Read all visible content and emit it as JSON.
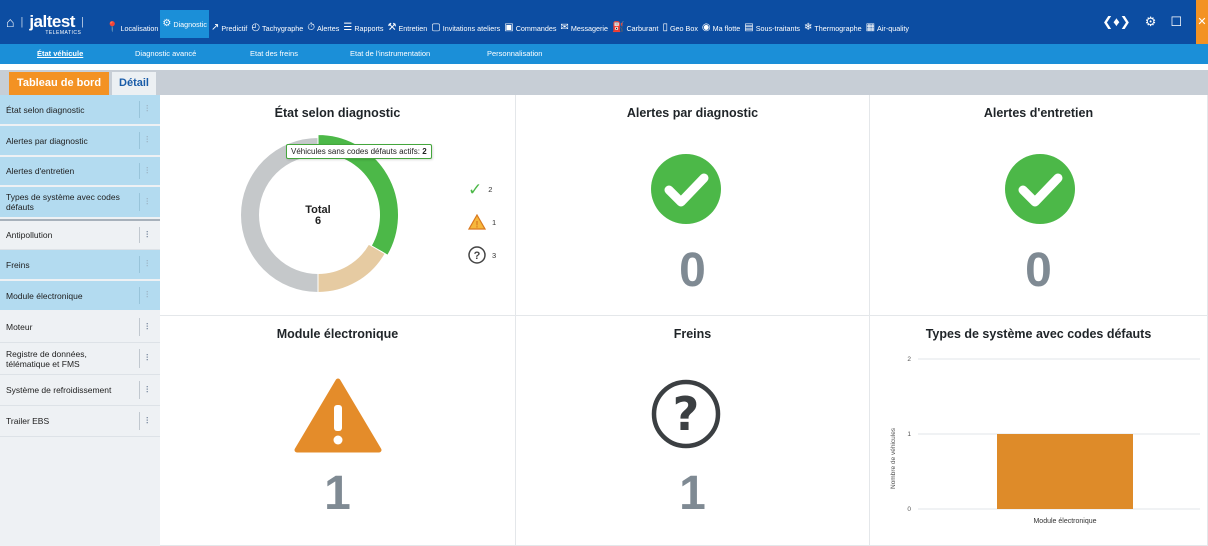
{
  "topnav": {
    "brand": "jaltest",
    "brand_sub": "TELEMATICS",
    "items": [
      {
        "icon": "location-pin-icon",
        "label": "Localisation"
      },
      {
        "icon": "diagnostic-icon",
        "label": "Diagnostic",
        "active": true
      },
      {
        "icon": "predictive-icon",
        "label": "Predictif"
      },
      {
        "icon": "tachograph-icon",
        "label": "Tachygraphe"
      },
      {
        "icon": "alert-icon",
        "label": "Alertes"
      },
      {
        "icon": "report-icon",
        "label": "Rapports"
      },
      {
        "icon": "maintenance-icon",
        "label": "Entretien"
      },
      {
        "icon": "workshop-invite-icon",
        "label": "Invitations ateliers"
      },
      {
        "icon": "order-box-icon",
        "label": "Commandes"
      },
      {
        "icon": "message-icon",
        "label": "Messagerie"
      },
      {
        "icon": "fuel-icon",
        "label": "Carburant"
      },
      {
        "icon": "geobox-icon",
        "label": "Geo Box"
      },
      {
        "icon": "fleet-icon",
        "label": "Ma flotte"
      },
      {
        "icon": "subcontractor-icon",
        "label": "Sous-traitants"
      },
      {
        "icon": "thermograph-icon",
        "label": "Thermographe"
      },
      {
        "icon": "air-quality-icon",
        "label": "Air-quality"
      }
    ],
    "right_icons": [
      "broadcast-icon",
      "gear-icon",
      "window-icon"
    ]
  },
  "subnav": {
    "items": [
      {
        "label": "État véhicule",
        "active": true
      },
      {
        "label": "Diagnostic avancé"
      },
      {
        "label": "Etat des freins"
      },
      {
        "label": "Etat de l'instrumentation"
      },
      {
        "label": "Personnalisation"
      }
    ]
  },
  "tabs": {
    "primary": "Tableau de bord",
    "secondary": "Détail"
  },
  "sidebar": {
    "items": [
      {
        "label": "État selon diagnostic",
        "selected": true
      },
      {
        "label": "Alertes par diagnostic",
        "selected": true
      },
      {
        "label": "Alertes d'entretien",
        "selected": true
      },
      {
        "label": "Types de système avec codes défauts",
        "selected": true
      },
      {
        "label": "Antipollution",
        "selected": false
      },
      {
        "label": "Freins",
        "selected": true
      },
      {
        "label": "Module électronique",
        "selected": true
      },
      {
        "label": "Moteur",
        "selected": false
      },
      {
        "label": "Registre de données, télématique et FMS",
        "selected": false
      },
      {
        "label": "Système de refroidissement",
        "selected": false
      },
      {
        "label": "Trailer EBS",
        "selected": false
      }
    ]
  },
  "tiles": {
    "etat": {
      "title": "État selon diagnostic",
      "total_label": "Total",
      "total": "6",
      "tooltip_text": "Véhicules sans codes défauts actifs:",
      "tooltip_value": "2",
      "legend": [
        {
          "icon": "checkmark-icon",
          "count": "2"
        },
        {
          "icon": "warning-icon",
          "count": "1"
        },
        {
          "icon": "question-icon",
          "count": "3"
        }
      ],
      "segments": [
        {
          "name": "ok",
          "value": 2,
          "color": "#4cb848"
        },
        {
          "name": "warning",
          "value": 1,
          "color": "#e6cba2"
        },
        {
          "name": "unknown",
          "value": 3,
          "color": "#c5c8ca"
        }
      ]
    },
    "alertes_diag": {
      "title": "Alertes par diagnostic",
      "value": "0"
    },
    "alertes_entretien": {
      "title": "Alertes d'entretien",
      "value": "0"
    },
    "module": {
      "title": "Module électronique",
      "value": "1"
    },
    "freins": {
      "title": "Freins",
      "value": "1"
    },
    "types": {
      "title": "Types de système avec codes défauts"
    }
  },
  "colors": {
    "nav": "#0c4da2",
    "subnav": "#1b8fd8",
    "accent": "#f39223",
    "ok": "#4cb848",
    "warning": "#e48c2a",
    "number": "#7f8a93"
  },
  "chart_data": {
    "type": "bar",
    "title": "Types de système avec codes défauts",
    "categories": [
      "Module électronique"
    ],
    "values": [
      1
    ],
    "ylabel": "Nombre de véhicules",
    "xlabel": "",
    "ylim": [
      0,
      2
    ],
    "yticks": [
      "0",
      "1",
      "2"
    ],
    "grid": true,
    "color": "#de8b29"
  }
}
